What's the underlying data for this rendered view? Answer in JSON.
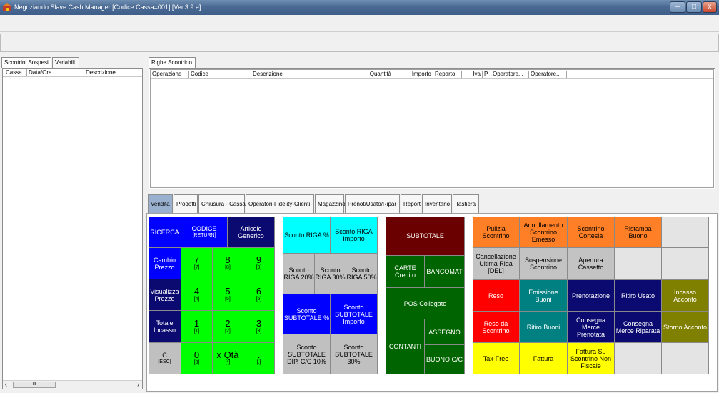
{
  "window": {
    "title": "Negoziando Slave Cash Manager [Codice Cassa=001] [Ver.3.9.e]",
    "min": "–",
    "max": "□",
    "close": "x"
  },
  "left": {
    "tabs": [
      "Scontrini Sospesi",
      "Variabili"
    ],
    "columns": [
      "Cassa",
      "Data/Ora",
      "Descrizione"
    ],
    "scroll_grip": "III",
    "scroll_left": "‹",
    "scroll_right": "›"
  },
  "receipt": {
    "tab": "Righe Scontrino",
    "columns": [
      "Operazione",
      "Codice",
      "Descrizione",
      "Quantità",
      "Importo",
      "Reparto",
      "Iva",
      "P.",
      "Operatore...",
      "Operatore..."
    ]
  },
  "main_tabs": [
    "Vendita",
    "Prodotti",
    "Chiusura - Cassa",
    "Operatori-Fidelity-Clienti",
    "Magazzino",
    "Prenot/Usato/Ripar",
    "Report",
    "Inventario",
    "Tastiera"
  ],
  "keypad": {
    "ricerca": "RICERCA",
    "codice": "CODICE",
    "codice_sub": "[RETURN]",
    "articolo": "Articolo Generico",
    "cambio": "Cambio Prezzo",
    "visualizza": "Visualizza Prezzo",
    "totale": "Totale Incasso",
    "c": "C",
    "c_sub": "[ESC]",
    "digits": [
      {
        "n": "7",
        "k": "[7]"
      },
      {
        "n": "8",
        "k": "[8]"
      },
      {
        "n": "9",
        "k": "[9]"
      },
      {
        "n": "4",
        "k": "[4]"
      },
      {
        "n": "5",
        "k": "[5]"
      },
      {
        "n": "6",
        "k": "[6]"
      },
      {
        "n": "1",
        "k": "[1]"
      },
      {
        "n": "2",
        "k": "[2]"
      },
      {
        "n": "3",
        "k": "[3]"
      }
    ],
    "zero": "0",
    "zero_sub": "[0]",
    "xqta": "x Qtà",
    "xqta_sub": "[*]",
    "dot": ".",
    "dot_sub": "[,]"
  },
  "discounts": {
    "riga_pct": "Sconto RIGA %",
    "riga_imp": "Sconto RIGA Importo",
    "r20": "Sconto RIGA 20%",
    "r30": "Sconto RIGA 30%",
    "r50": "Sconto RIGA 50%",
    "sub_pct": "Sconto SUBTOTALE %",
    "sub_imp": "Sconto SUBTOTALE Importo",
    "sub_dip": "Sconto SUBTOTALE DIP. C/C 10%",
    "sub_30": "Sconto SUBTOTALE 30%"
  },
  "payment": {
    "subtotale": "SUBTOTALE",
    "carte": "CARTE Credito",
    "bancomat": "BANCOMAT",
    "pos": "POS Collegato",
    "contanti": "CONTANTI",
    "assegno": "ASSEGNO",
    "buono": "BUONO C/C"
  },
  "functions": {
    "pulizia": "Pulizia Scontrino",
    "annullamento": "Annullamento Scontrino Emesso",
    "cortesia": "Scontrino Cortesia",
    "ristampa": "Ristampa Buono",
    "cancellazione": "Cancellazione Ultima Riga [DEL]",
    "sospensione": "Sospensione Scontrino",
    "apertura": "Apertura Cassetto",
    "reso": "Reso",
    "emissione": "Emissione Buoni",
    "prenotazione": "Prenotazione",
    "ritiro_usato": "Ritiro Usato",
    "incasso_acconto": "Incasso Acconto",
    "reso_scontrino": "Reso da Scontrino",
    "ritiro_buoni": "Ritiro Buoni",
    "consegna_prenotata": "Consegna Merce Prenotata",
    "consegna_riparata": "Consegna Merce Riparata",
    "storno": "Storno Acconto",
    "taxfree": "Tax-Free",
    "fattura": "Fattura",
    "fattura_nf": "Fattura Su Scontrino Non Fiscale"
  }
}
